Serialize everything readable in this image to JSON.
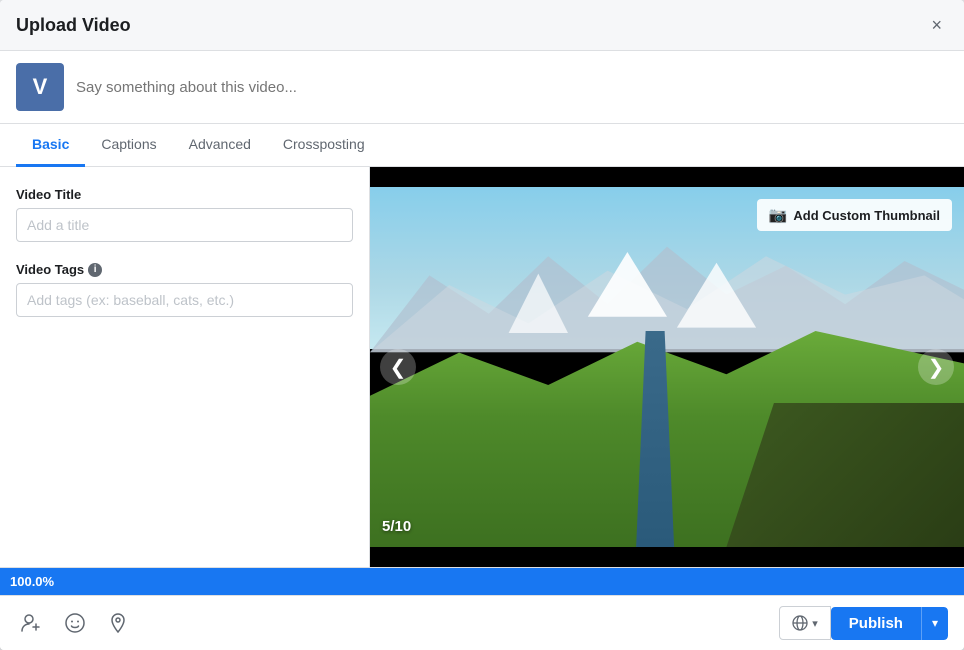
{
  "modal": {
    "title": "Upload Video",
    "close_label": "×"
  },
  "status": {
    "avatar_letter": "V",
    "placeholder": "Say something about this video..."
  },
  "tabs": [
    {
      "id": "basic",
      "label": "Basic",
      "active": true
    },
    {
      "id": "captions",
      "label": "Captions",
      "active": false
    },
    {
      "id": "advanced",
      "label": "Advanced",
      "active": false
    },
    {
      "id": "crossposting",
      "label": "Crossposting",
      "active": false
    }
  ],
  "form": {
    "title_label": "Video Title",
    "title_placeholder": "Add a title",
    "tags_label": "Video Tags",
    "tags_placeholder": "Add tags (ex: baseball, cats, etc.)"
  },
  "video": {
    "add_thumbnail_label": "Add Custom Thumbnail",
    "slide_counter": "5/10",
    "left_arrow": "❮",
    "right_arrow": "❯"
  },
  "progress": {
    "percent": 100,
    "label": "100.0%"
  },
  "footer": {
    "tag_friend_icon": "👤",
    "emoji_icon": "😊",
    "location_icon": "📍",
    "audience_icon": "🌐",
    "audience_dropdown_icon": "▾",
    "publish_label": "Publish",
    "publish_dropdown_icon": "▾"
  }
}
